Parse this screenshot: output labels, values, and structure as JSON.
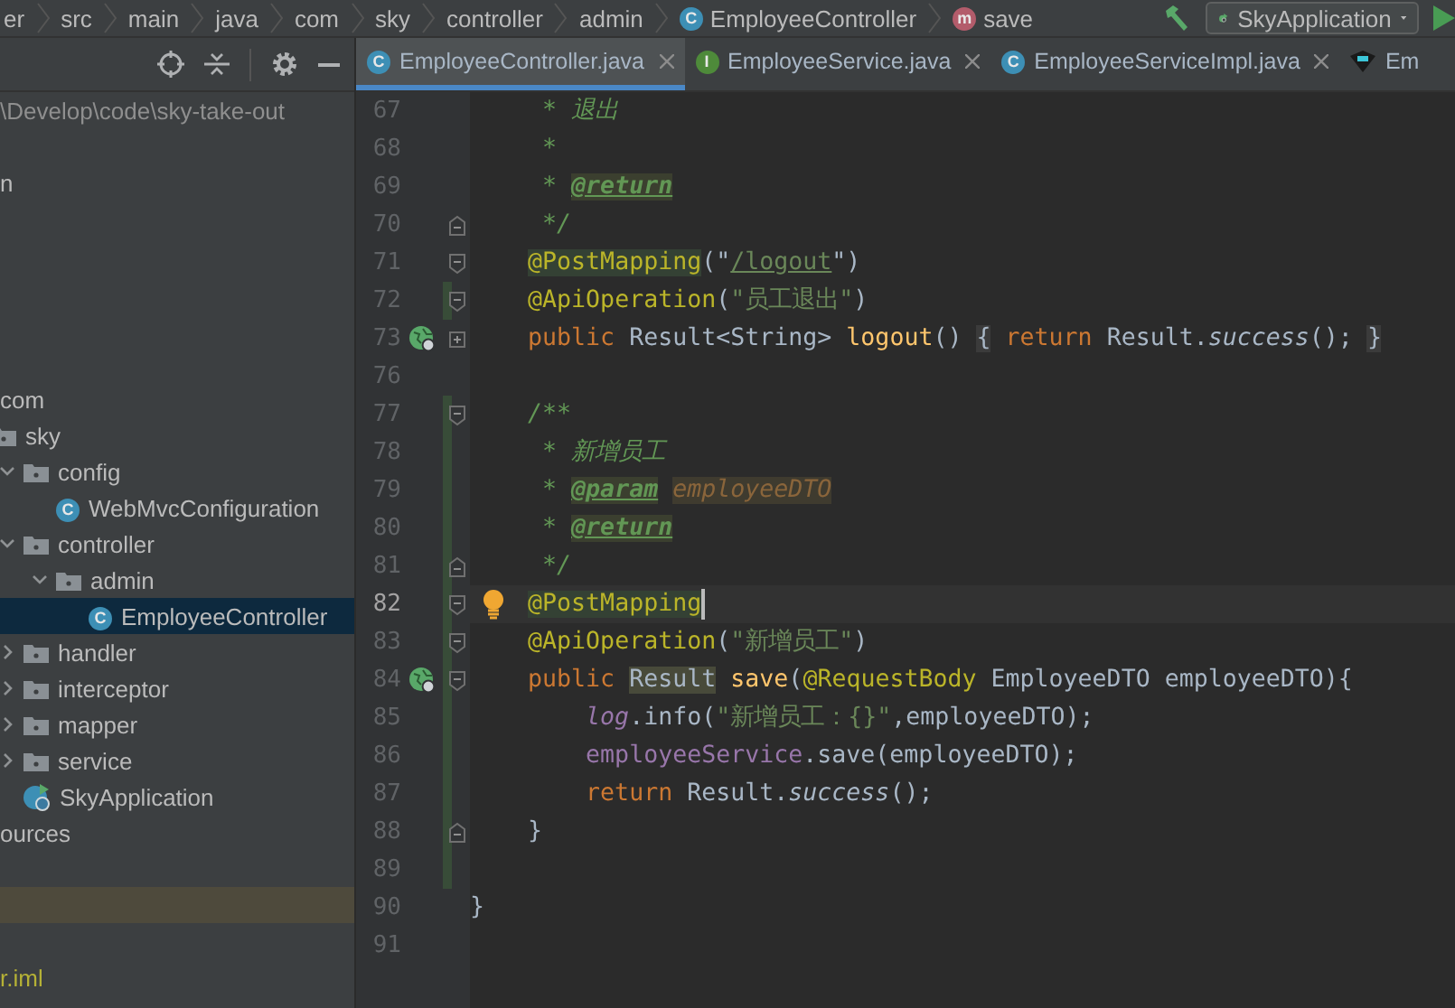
{
  "breadcrumb": [
    {
      "label": "er",
      "kind": "folder"
    },
    {
      "label": "src",
      "kind": "folder"
    },
    {
      "label": "main",
      "kind": "folder"
    },
    {
      "label": "java",
      "kind": "folder"
    },
    {
      "label": "com",
      "kind": "folder"
    },
    {
      "label": "sky",
      "kind": "folder"
    },
    {
      "label": "controller",
      "kind": "folder"
    },
    {
      "label": "admin",
      "kind": "folder"
    },
    {
      "label": "EmployeeController",
      "kind": "class",
      "badge": "C"
    },
    {
      "label": "save",
      "kind": "method",
      "badge": "m"
    }
  ],
  "run_config": {
    "label": "SkyApplication"
  },
  "tabs": [
    {
      "label": "EmployeeController.java",
      "badge": "C",
      "kind": "class",
      "selected": true
    },
    {
      "label": "EmployeeService.java",
      "badge": "I",
      "kind": "interface",
      "selected": false
    },
    {
      "label": "EmployeeServiceImpl.java",
      "badge": "C",
      "kind": "class",
      "selected": false
    },
    {
      "label": "Em",
      "kind": "other",
      "selected": false
    }
  ],
  "tree": [
    {
      "label": "\\Develop\\code\\sky-take-out",
      "kind": "path"
    },
    {
      "label": "n",
      "kind": "text"
    },
    {
      "label": "com",
      "kind": "text",
      "children": [
        {
          "label": "sky",
          "kind": "package",
          "children": [
            {
              "label": "config",
              "kind": "package",
              "expanded": true,
              "children": [
                {
                  "label": "WebMvcConfiguration",
                  "kind": "class",
                  "badge": "C",
                  "selected": false
                }
              ]
            },
            {
              "label": "controller",
              "kind": "package",
              "expanded": true,
              "children": [
                {
                  "label": "admin",
                  "kind": "package",
                  "expanded": true,
                  "children": [
                    {
                      "label": "EmployeeController",
                      "kind": "class",
                      "badge": "C",
                      "selected": true
                    }
                  ]
                }
              ]
            },
            {
              "label": "handler",
              "kind": "package",
              "expanded": false
            },
            {
              "label": "interceptor",
              "kind": "package",
              "expanded": false
            },
            {
              "label": "mapper",
              "kind": "package",
              "expanded": false
            },
            {
              "label": "service",
              "kind": "package",
              "expanded": false
            },
            {
              "label": "SkyApplication",
              "kind": "app"
            }
          ]
        }
      ]
    },
    {
      "label": "ources",
      "kind": "text"
    },
    {
      "label": "r.iml",
      "kind": "file"
    }
  ],
  "code": [
    {
      "number": "67",
      "current": false,
      "tokens": [
        {
          "t": "     * 退出",
          "kind": "doc"
        }
      ]
    },
    {
      "number": "68",
      "current": false,
      "tokens": [
        {
          "t": "     *",
          "kind": "doc"
        }
      ]
    },
    {
      "number": "69",
      "current": false,
      "tokens": [
        {
          "t": "     * ",
          "kind": "doc"
        },
        {
          "t": "@return",
          "kind": "doctag"
        }
      ]
    },
    {
      "number": "70",
      "current": false,
      "fold_close": true,
      "tokens": [
        {
          "t": "     */",
          "kind": "doc"
        }
      ]
    },
    {
      "number": "71",
      "current": false,
      "fold_open": true,
      "tokens": [
        {
          "t": "    @PostMapping",
          "kind": "annotation_hl"
        },
        {
          "t": "(\"",
          "kind": "plain"
        },
        {
          "t": "/logout",
          "kind": "url"
        },
        {
          "t": "\")",
          "kind": "plain"
        }
      ]
    },
    {
      "number": "72",
      "current": false,
      "fold_open": true,
      "changed": true,
      "tokens": [
        {
          "t": "    @ApiOperation",
          "kind": "annotation"
        },
        {
          "t": "(",
          "kind": "plain"
        },
        {
          "t": "\"员工退出\"",
          "kind": "string"
        },
        {
          "t": ")",
          "kind": "plain"
        }
      ]
    },
    {
      "number": "73",
      "current": false,
      "collapsed": true,
      "endpoint": true,
      "tokens": [
        {
          "t": "    public ",
          "kind": "keyword"
        },
        {
          "t": "Result<String> ",
          "kind": "plain"
        },
        {
          "t": "logout",
          "kind": "method"
        },
        {
          "t": "() ",
          "kind": "plain"
        },
        {
          "t": "{",
          "kind": "folded"
        },
        {
          "t": " return ",
          "kind": "keyword"
        },
        {
          "t": "Result.",
          "kind": "plain"
        },
        {
          "t": "success",
          "kind": "static"
        },
        {
          "t": "(); ",
          "kind": "plain"
        },
        {
          "t": "}",
          "kind": "folded"
        }
      ]
    },
    {
      "number": "76",
      "current": false
    },
    {
      "number": "77",
      "current": false,
      "fold_open": true,
      "changed": true,
      "tokens": [
        {
          "t": "    /**",
          "kind": "doc"
        }
      ]
    },
    {
      "number": "78",
      "current": false,
      "changed": true,
      "tokens": [
        {
          "t": "     * 新增员工",
          "kind": "doc"
        }
      ]
    },
    {
      "number": "79",
      "current": false,
      "changed": true,
      "tokens": [
        {
          "t": "     * ",
          "kind": "doc"
        },
        {
          "t": "@param",
          "kind": "doctag"
        },
        {
          "t": " employeeDTO",
          "kind": "docparam"
        }
      ]
    },
    {
      "number": "80",
      "current": false,
      "changed": true,
      "tokens": [
        {
          "t": "     * ",
          "kind": "doc"
        },
        {
          "t": "@return",
          "kind": "doctag"
        }
      ]
    },
    {
      "number": "81",
      "current": false,
      "fold_close": true,
      "changed": true,
      "tokens": [
        {
          "t": "     */",
          "kind": "doc"
        }
      ]
    },
    {
      "number": "82",
      "current": true,
      "fold_open": true,
      "changed": true,
      "intention": true,
      "caret": true,
      "tokens": [
        {
          "t": "    @PostMapping",
          "kind": "annotation_hl"
        }
      ]
    },
    {
      "number": "83",
      "current": false,
      "fold_open": true,
      "changed": true,
      "tokens": [
        {
          "t": "    @ApiOperation",
          "kind": "annotation"
        },
        {
          "t": "(",
          "kind": "plain"
        },
        {
          "t": "\"新增员工\"",
          "kind": "string"
        },
        {
          "t": ")",
          "kind": "plain"
        }
      ]
    },
    {
      "number": "84",
      "current": false,
      "fold_open": true,
      "changed": true,
      "endpoint": true,
      "tokens": [
        {
          "t": "    public ",
          "kind": "keyword"
        },
        {
          "t": "Result",
          "kind": "ident_hl"
        },
        {
          "t": " save",
          "kind": "method"
        },
        {
          "t": "(",
          "kind": "plain"
        },
        {
          "t": "@RequestBody ",
          "kind": "annotation"
        },
        {
          "t": "EmployeeDTO employeeDTO){",
          "kind": "plain"
        }
      ]
    },
    {
      "number": "85",
      "current": false,
      "changed": true,
      "tokens": [
        {
          "t": "        log",
          "kind": "static_field"
        },
        {
          "t": ".info(",
          "kind": "plain"
        },
        {
          "t": "\"新增员工：{}\"",
          "kind": "string"
        },
        {
          "t": ",employeeDTO);",
          "kind": "plain"
        }
      ]
    },
    {
      "number": "86",
      "current": false,
      "changed": true,
      "tokens": [
        {
          "t": "        employeeService",
          "kind": "field"
        },
        {
          "t": ".save(employeeDTO);",
          "kind": "plain"
        }
      ]
    },
    {
      "number": "87",
      "current": false,
      "changed": true,
      "tokens": [
        {
          "t": "        return ",
          "kind": "keyword"
        },
        {
          "t": "Result.",
          "kind": "plain"
        },
        {
          "t": "success",
          "kind": "static"
        },
        {
          "t": "();",
          "kind": "plain"
        }
      ]
    },
    {
      "number": "88",
      "current": false,
      "fold_close": true,
      "changed": true,
      "tokens": [
        {
          "t": "    }",
          "kind": "plain"
        }
      ]
    },
    {
      "number": "89",
      "current": false,
      "changed": true
    },
    {
      "number": "90",
      "current": false,
      "tokens": [
        {
          "t": "}",
          "kind": "plain"
        }
      ]
    },
    {
      "number": "91",
      "current": false
    }
  ]
}
